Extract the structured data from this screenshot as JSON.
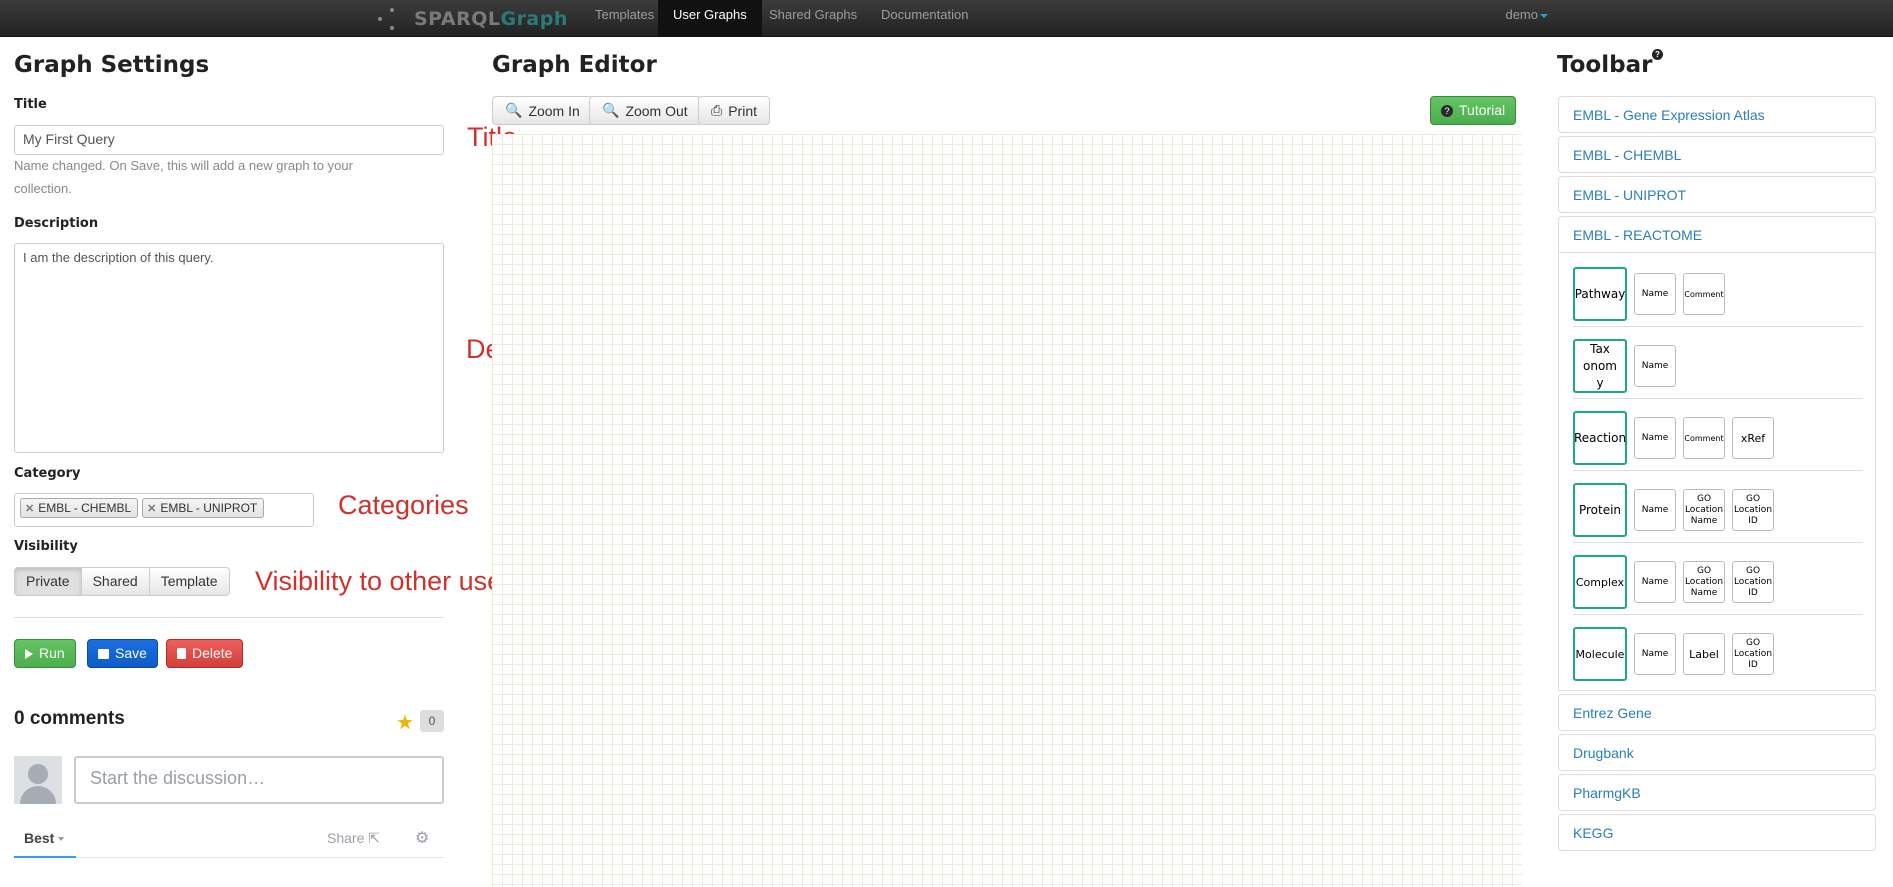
{
  "nav": {
    "brand_part1": "SPARQL",
    "brand_part2": "Graph",
    "items": [
      "Templates",
      "User Graphs",
      "Shared Graphs",
      "Documentation"
    ],
    "active": "User Graphs",
    "user": "demo"
  },
  "settings": {
    "heading": "Graph Settings",
    "title_label": "Title",
    "title_value": "My First Query",
    "title_help": "Name changed. On Save, this will add a new graph to your collection.",
    "description_label": "Description",
    "description_value": "I am the description of this query.",
    "category_label": "Category",
    "categories": [
      "EMBL - CHEMBL",
      "EMBL - UNIPROT"
    ],
    "visibility_label": "Visibility",
    "visibility_options": [
      "Private",
      "Shared",
      "Template"
    ],
    "visibility_selected": "Private",
    "run_label": "Run",
    "save_label": "Save",
    "delete_label": "Delete"
  },
  "annotations": {
    "title": "Title",
    "description": "Description",
    "categories": "Categories",
    "visibility": "Visibility to other users"
  },
  "comments": {
    "count_label": "0 comments",
    "star_count": "0",
    "placeholder": "Start the discussion…",
    "sort_label": "Best",
    "share_label": "Share"
  },
  "editor": {
    "heading": "Graph Editor",
    "zoom_in_label": "Zoom In",
    "zoom_out_label": "Zoom Out",
    "print_label": "Print",
    "tutorial_label": "Tutorial"
  },
  "toolbar": {
    "heading": "Toolbar",
    "help_mark": "?",
    "top_items": [
      "EMBL - Gene Expression Atlas",
      "EMBL - CHEMBL",
      "EMBL - UNIPROT",
      "EMBL - REACTOME"
    ],
    "reactome_rows": [
      {
        "main": "Pathway",
        "props": [
          "Name",
          "Comment"
        ]
      },
      {
        "main": "Tax onomy",
        "props": [
          "Name"
        ]
      },
      {
        "main": "Reaction",
        "props": [
          "Name",
          "Comment",
          "xRef"
        ]
      },
      {
        "main": "Protein",
        "props": [
          "Name",
          "GO Location Name",
          "GO Location ID"
        ]
      },
      {
        "main": "Complex",
        "props": [
          "Name",
          "GO Location Name",
          "GO Location ID"
        ]
      },
      {
        "main": "Molecule",
        "props": [
          "Name",
          "Label",
          "GO Location ID"
        ]
      }
    ],
    "bottom_items": [
      "Entrez Gene",
      "Drugbank",
      "PharmgKB",
      "KEGG"
    ]
  },
  "colors": {
    "run": "#4cae4c",
    "save": "#0e5cc9",
    "delete": "#d43f3a",
    "tutorial": "#4cae4c",
    "link": "#2a7fb5",
    "node_border": "#1aaa8a",
    "annotation": "#d0312d"
  }
}
